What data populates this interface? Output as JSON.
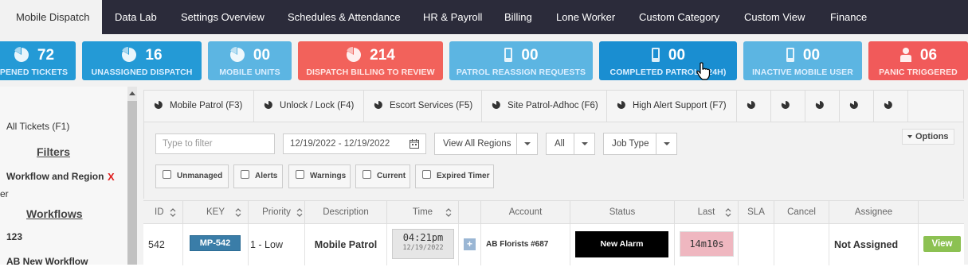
{
  "topnav": {
    "tabs": [
      {
        "label": "Mobile Dispatch",
        "active": true
      },
      {
        "label": "Data Lab"
      },
      {
        "label": "Settings Overview"
      },
      {
        "label": "Schedules & Attendance"
      },
      {
        "label": "HR & Payroll"
      },
      {
        "label": "Billing"
      },
      {
        "label": "Lone Worker"
      },
      {
        "label": "Custom Category"
      },
      {
        "label": "Custom View"
      },
      {
        "label": "Finance"
      }
    ]
  },
  "cards": [
    {
      "count": "72",
      "label": "PENED TICKETS",
      "icon": "pie-chart-icon",
      "color": "#249ad6"
    },
    {
      "count": "16",
      "label": "UNASSIGNED DISPATCH",
      "icon": "pie-chart-icon",
      "color": "#249ad6"
    },
    {
      "count": "00",
      "label": "MOBILE UNITS",
      "icon": "pie-chart-icon",
      "color": "#5cb5e2"
    },
    {
      "count": "214",
      "label": "DISPATCH BILLING TO REVIEW",
      "icon": "pie-chart-icon",
      "color": "#f2625b"
    },
    {
      "count": "00",
      "label": "PATROL REASSIGN REQUESTS",
      "icon": "mobile-phone-icon",
      "color": "#5cb5e2"
    },
    {
      "count": "00",
      "label": "COMPLETED PATROLS(24H)",
      "icon": "mobile-phone-icon",
      "color": "#1a8ed1"
    },
    {
      "count": "00",
      "label": "INACTIVE MOBILE USER",
      "icon": "mobile-phone-icon",
      "color": "#5cb5e2"
    },
    {
      "count": "06",
      "label": "PANIC TRIGGERED",
      "icon": "person-alert-icon",
      "color": "#f15a5a"
    }
  ],
  "sidebar": {
    "all_tickets": "All Tickets (F1)",
    "filters_heading": "Filters",
    "workflow_region": "Workflow and Region",
    "workflow_region_x": "X",
    "er_fragment": "er",
    "workflows_heading": "Workflows",
    "workflow_123": "123",
    "ab_new_workflow": "AB New Workflow"
  },
  "job_tabs": [
    {
      "label": "Mobile Patrol (F3)"
    },
    {
      "label": "Unlock / Lock (F4)"
    },
    {
      "label": "Escort Services (F5)"
    },
    {
      "label": "Site Patrol-Adhoc (F6)"
    },
    {
      "label": "High Alert Support (F7)"
    },
    {
      "label": ""
    },
    {
      "label": ""
    },
    {
      "label": ""
    },
    {
      "label": ""
    },
    {
      "label": ""
    }
  ],
  "filters": {
    "search_placeholder": "Type to filter",
    "date_range": "12/19/2022 - 12/19/2022",
    "region_select": "View All Regions",
    "all_select": "All",
    "job_type_select": "Job Type",
    "options_button": "Options",
    "checkboxes": [
      {
        "label": "Unmanaged"
      },
      {
        "label": "Alerts"
      },
      {
        "label": "Warnings"
      },
      {
        "label": "Current"
      },
      {
        "label": "Expired Timer"
      }
    ]
  },
  "table": {
    "headers": [
      "ID",
      "KEY",
      "Priority",
      "Description",
      "Time",
      "",
      "Account",
      "Status",
      "Last",
      "SLA",
      "Cancel",
      "Assignee",
      ""
    ],
    "row": {
      "id": "542",
      "key": "MP-542",
      "priority": "1 - Low",
      "description": "Mobile Patrol",
      "time": "04:21pm",
      "date": "12/19/2022",
      "plus": "+",
      "account": "AB Florists #687",
      "status": "New Alarm",
      "last": "14m10s",
      "assignee": "Not Assigned",
      "view": "View"
    }
  }
}
